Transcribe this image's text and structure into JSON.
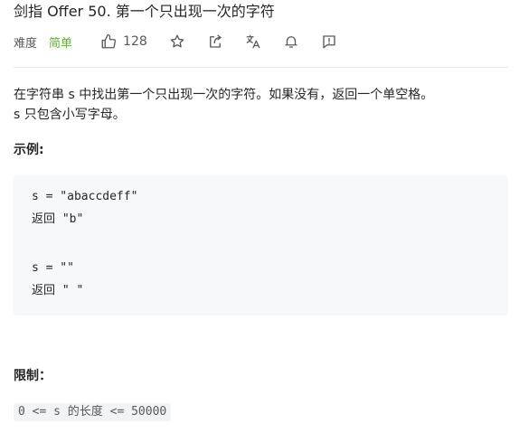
{
  "problem": {
    "title": "剑指 Offer 50. 第一个只出现一次的字符",
    "difficulty_label": "难度",
    "difficulty": "简单",
    "like_count": "128"
  },
  "toolbar": {
    "icons": [
      "thumbs-up-icon",
      "star-icon",
      "share-icon",
      "translate-icon",
      "bell-icon",
      "feedback-icon"
    ]
  },
  "description": {
    "line1": "在字符串 s 中找出第一个只出现一次的字符。如果没有，返回一个单空格。",
    "line2": "s 只包含小写字母。"
  },
  "example": {
    "heading": "示例:",
    "lines": [
      "s = \"abaccdeff\"",
      "返回 \"b\"",
      "s = \"\"",
      "返回 \" \""
    ]
  },
  "constraints": {
    "heading": "限制：",
    "items": [
      "0 <= s 的长度 <= 50000"
    ]
  },
  "colors": {
    "difficulty_easy": "#5ab726",
    "text": "#262626",
    "icon": "#595959",
    "code_background": "#f7f8fa"
  }
}
